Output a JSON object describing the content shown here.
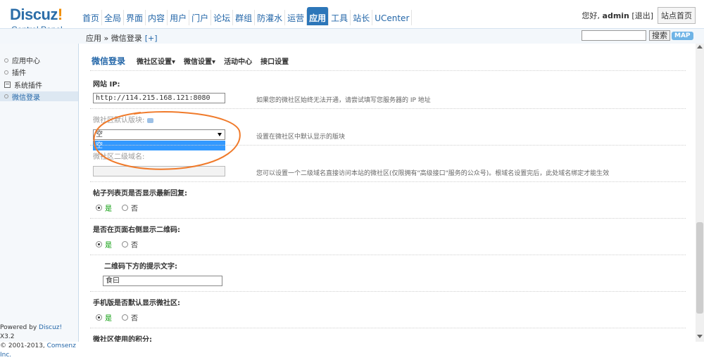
{
  "header": {
    "logo_main": "Discuz",
    "logo_ex": "!",
    "logo_sub": "Control Panel",
    "nav": [
      "首页",
      "全局",
      "界面",
      "内容",
      "用户",
      "门户",
      "论坛",
      "群组",
      "防灌水",
      "运营",
      "应用",
      "工具",
      "站长",
      "UCenter"
    ],
    "active_nav": "应用",
    "greeting_prefix": "您好, ",
    "username": "admin",
    "logout": "[退出]",
    "home_button": "站点首页"
  },
  "subbar": {
    "breadcrumb": "应用 » 微信登录",
    "add_link": "[+]",
    "search_value": "",
    "search_button": "搜索",
    "map_button": "MAP"
  },
  "sidebar": {
    "items": [
      "应用中心",
      "插件",
      "系统插件",
      "微信登录"
    ],
    "selected": "微信登录",
    "footer_line1_prefix": "Powered by ",
    "footer_line1_link": "Discuz!",
    "footer_line1_suffix": " X3.2",
    "footer_line2_prefix": "© 2001-2013, ",
    "footer_line2_link": "Comsenz Inc."
  },
  "tabs": {
    "main": "微信登录",
    "items": [
      "微社区设置▾",
      "微信设置▾",
      "活动中心",
      "接口设置"
    ]
  },
  "form": {
    "site_ip_label": "网站 IP:",
    "site_ip_value": "http://114.215.168.121:8080",
    "site_ip_hint": "如果您的微社区始终无法开通，请尝试填写您服务器的 IP 地址",
    "default_block_label": "微社区默认版块:",
    "default_block_value": "空",
    "default_block_option": "空",
    "default_block_hint": "设置在微社区中默认显示的版块",
    "subdomain_label": "微社区二级域名:",
    "subdomain_value": "",
    "subdomain_hint": "您可以设置一个二级域名直接访问本站的微社区(仅限拥有\"高级接口\"服务的公众号)。根域名设置完后，此处域名绑定才能生效",
    "latest_reply_label": "帖子列表页是否显示最新回复:",
    "qrcode_label": "是否在页面右侧显示二维码:",
    "qrcode_text_label": "二维码下方的提示文字:",
    "qrcode_text_value": "食曰",
    "mobile_default_label": "手机版是否默认显示微社区:",
    "credits_label": "微社区使用的积分:",
    "yes": "是",
    "no": "否"
  },
  "colors": {
    "brand": "#2b6da8",
    "active_nav": "#2c76b9",
    "annotation": "#f07a2a"
  }
}
